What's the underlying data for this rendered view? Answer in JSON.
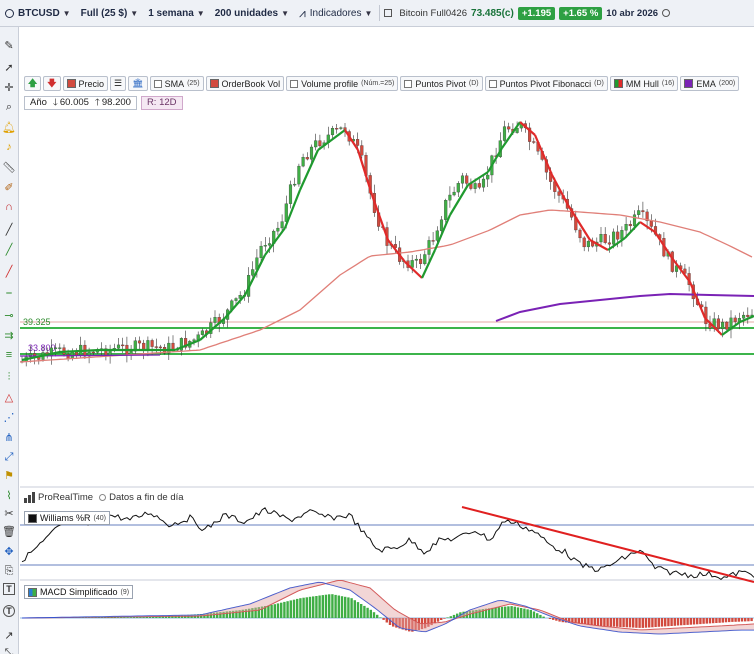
{
  "toolbar": {
    "symbol": "BTCUSD",
    "account": "Full (25 $)",
    "timeframe": "1 semana",
    "units": "200 unidades",
    "indicators": "Indicadores",
    "instrument_name": "Bitcoin Full0426",
    "price": "73.485(c)",
    "change_abs": "+1.195",
    "change_pct": "+1.65 %",
    "date": "10 abr 2026"
  },
  "indicator_bar": {
    "price_label": "Precio",
    "sma_label": "SMA",
    "sma_param": "(25)",
    "orderbook_label": "OrderBook Vol",
    "volume_profile_label": "Volume profile",
    "volume_profile_param": "(Núm.=25)",
    "pivot_label": "Puntos Pivot",
    "pivot_param": "(D)",
    "pivot_fib_label": "Puntos Pivot Fibonacci",
    "pivot_fib_param": "(D)",
    "hull_label": "MM Hull",
    "hull_param": "(16)",
    "ema_label": "EMA",
    "ema_param": "(200)"
  },
  "range_bar": {
    "year_label": "Año",
    "low": "60.005",
    "high": "98.200",
    "r_tag": "R: 12D"
  },
  "levels": {
    "level1": "39.325",
    "level2": "33.800"
  },
  "footer": {
    "brand": "ProRealTime",
    "data_mode": "Datos a fin de día"
  },
  "williams": {
    "label": "Williams %R",
    "param": "(40)"
  },
  "macd": {
    "label": "MACD Simplificado",
    "param": "(9)"
  },
  "colors": {
    "up": "#3fae45",
    "down": "#d24a3e",
    "hull_up": "#1f9a2f",
    "hull_down": "#e02a2a",
    "sma": "#e07f78",
    "ema": "#7a22b5",
    "support": "#3cb44b",
    "trendline": "#e02020"
  }
}
